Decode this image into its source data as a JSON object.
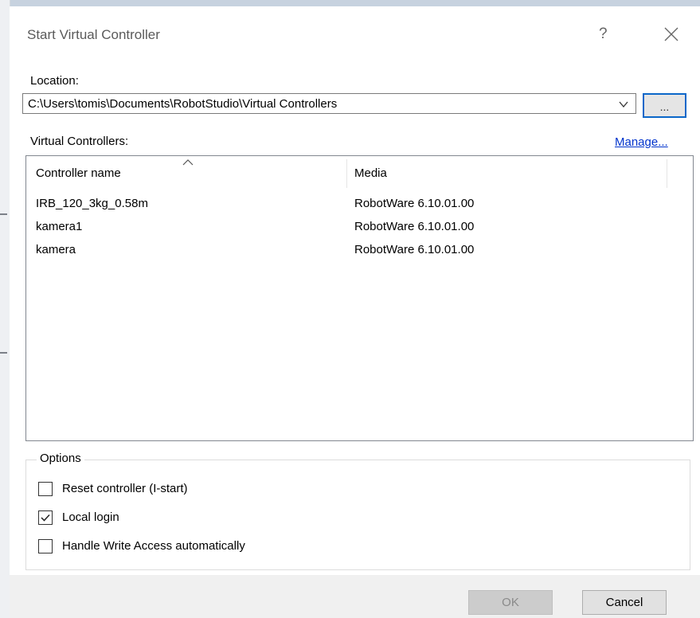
{
  "dialog": {
    "title": "Start Virtual Controller",
    "help_label": "?",
    "close_icon": "close-icon"
  },
  "location": {
    "label": "Location:",
    "value": "C:\\Users\\tomis\\Documents\\RobotStudio\\Virtual Controllers",
    "dropdown_icon": "chevron-down-icon",
    "browse_label": "..."
  },
  "controllers": {
    "label": "Virtual Controllers:",
    "manage_link": "Manage...",
    "columns": [
      "Controller name",
      "Media"
    ],
    "sort_icon": "sort-ascending-icon",
    "rows": [
      {
        "name": "IRB_120_3kg_0.58m",
        "media": "RobotWare 6.10.01.00"
      },
      {
        "name": "kamera1",
        "media": "RobotWare 6.10.01.00"
      },
      {
        "name": "kamera",
        "media": "RobotWare 6.10.01.00"
      }
    ]
  },
  "options": {
    "legend": "Options",
    "items": [
      {
        "label": "Reset controller (I-start)",
        "checked": false
      },
      {
        "label": "Local login",
        "checked": true
      },
      {
        "label": "Handle Write Access automatically",
        "checked": false
      }
    ]
  },
  "buttons": {
    "ok": "OK",
    "cancel": "Cancel"
  },
  "colors": {
    "accent": "#0b67c9",
    "link": "#0033cc",
    "footer": "#f0f0f0"
  }
}
